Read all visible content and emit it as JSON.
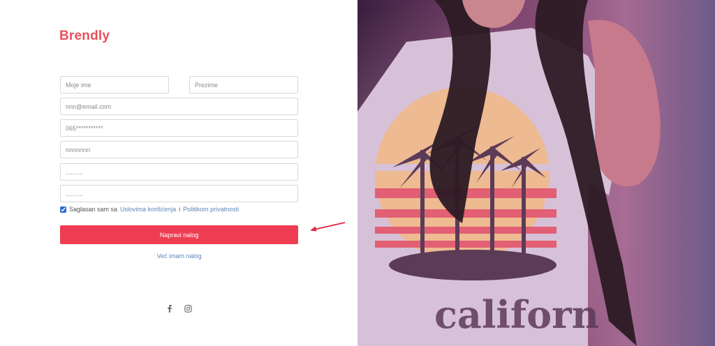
{
  "brand": {
    "name": "Brendly",
    "color": "#ec4f5c"
  },
  "form": {
    "first_name_placeholder": "Moje ime",
    "last_name_placeholder": "Prezime",
    "email_placeholder": "nnn@email.com",
    "phone_placeholder": "065***********",
    "username_placeholder": "nnnnnnn",
    "password_placeholder": "..........",
    "confirm_password_placeholder": ".........."
  },
  "terms": {
    "checked": true,
    "prefix": "Saglasan sam sa",
    "terms_link": "Uslovima korišćenja",
    "separator": "i",
    "privacy_link": "Politikom privatnosti"
  },
  "submit_label": "Napravi nalog",
  "login_link": "Već imam nalog",
  "social": [
    "facebook-icon",
    "instagram-icon"
  ],
  "accent_button": "#ee3d52",
  "arrow_color": "#e0243a"
}
